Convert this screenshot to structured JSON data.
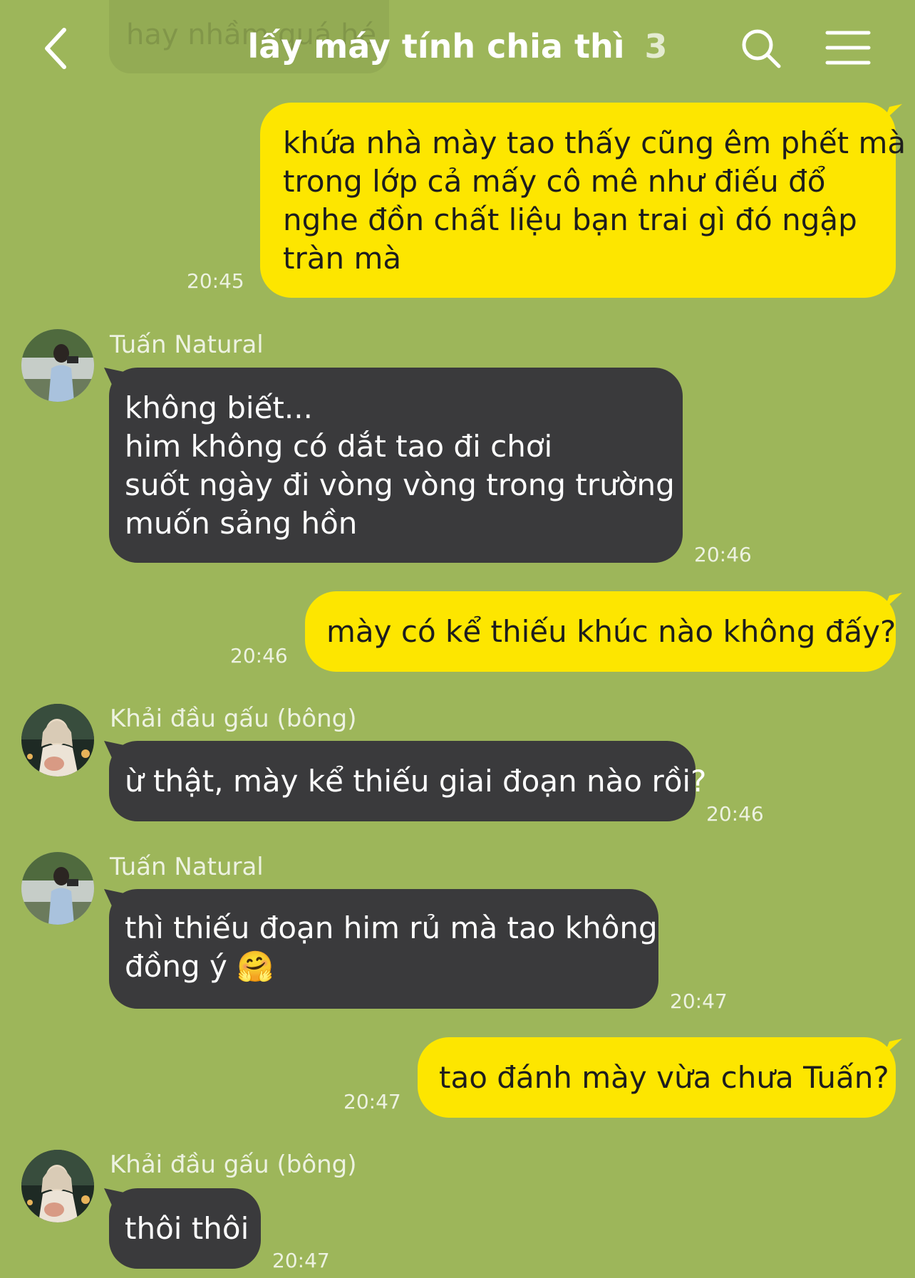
{
  "background_color": "#9db65a",
  "ghost_message": "hay nhầm quá hé",
  "header": {
    "back_icon": "chevron-left-icon",
    "title": "lấy máy tính chia thì",
    "member_count": "3",
    "search_icon": "search-icon",
    "menu_icon": "menu-icon"
  },
  "messages": [
    {
      "direction": "outgoing",
      "lines": [
        "khứa nhà mày tao thấy cũng êm phết mà",
        "trong lớp cả mấy cô mê như điếu đổ",
        "nghe đồn chất liệu bạn trai gì đó ngập",
        "tràn mà"
      ],
      "time": "20:45"
    },
    {
      "direction": "incoming",
      "sender": "Tuấn Natural",
      "lines": [
        "không biết...",
        "him không có dắt tao đi chơi",
        "suốt ngày đi vòng vòng trong trường",
        "muốn sảng hồn"
      ],
      "time": "20:46"
    },
    {
      "direction": "outgoing",
      "lines": [
        "mày có kể thiếu khúc nào không đấy?"
      ],
      "time": "20:46"
    },
    {
      "direction": "incoming",
      "sender": "Khải đầu gấu (bông)",
      "lines": [
        "ừ thật, mày kể thiếu giai đoạn nào rồi?"
      ],
      "time": "20:46"
    },
    {
      "direction": "incoming",
      "sender": "Tuấn Natural",
      "lines": [
        "thì thiếu đoạn him rủ mà tao không",
        "đồng ý 🤗"
      ],
      "time": "20:47"
    },
    {
      "direction": "outgoing",
      "lines": [
        "tao đánh mày vừa chưa Tuấn?"
      ],
      "time": "20:47"
    },
    {
      "direction": "incoming",
      "sender": "Khải đầu gấu (bông)",
      "lines": [
        "thôi thôi"
      ],
      "time": "20:47"
    }
  ],
  "colors": {
    "outgoing_bubble": "#fde600",
    "incoming_bubble": "#3a3a3c",
    "meta_text": "#ffffff"
  }
}
